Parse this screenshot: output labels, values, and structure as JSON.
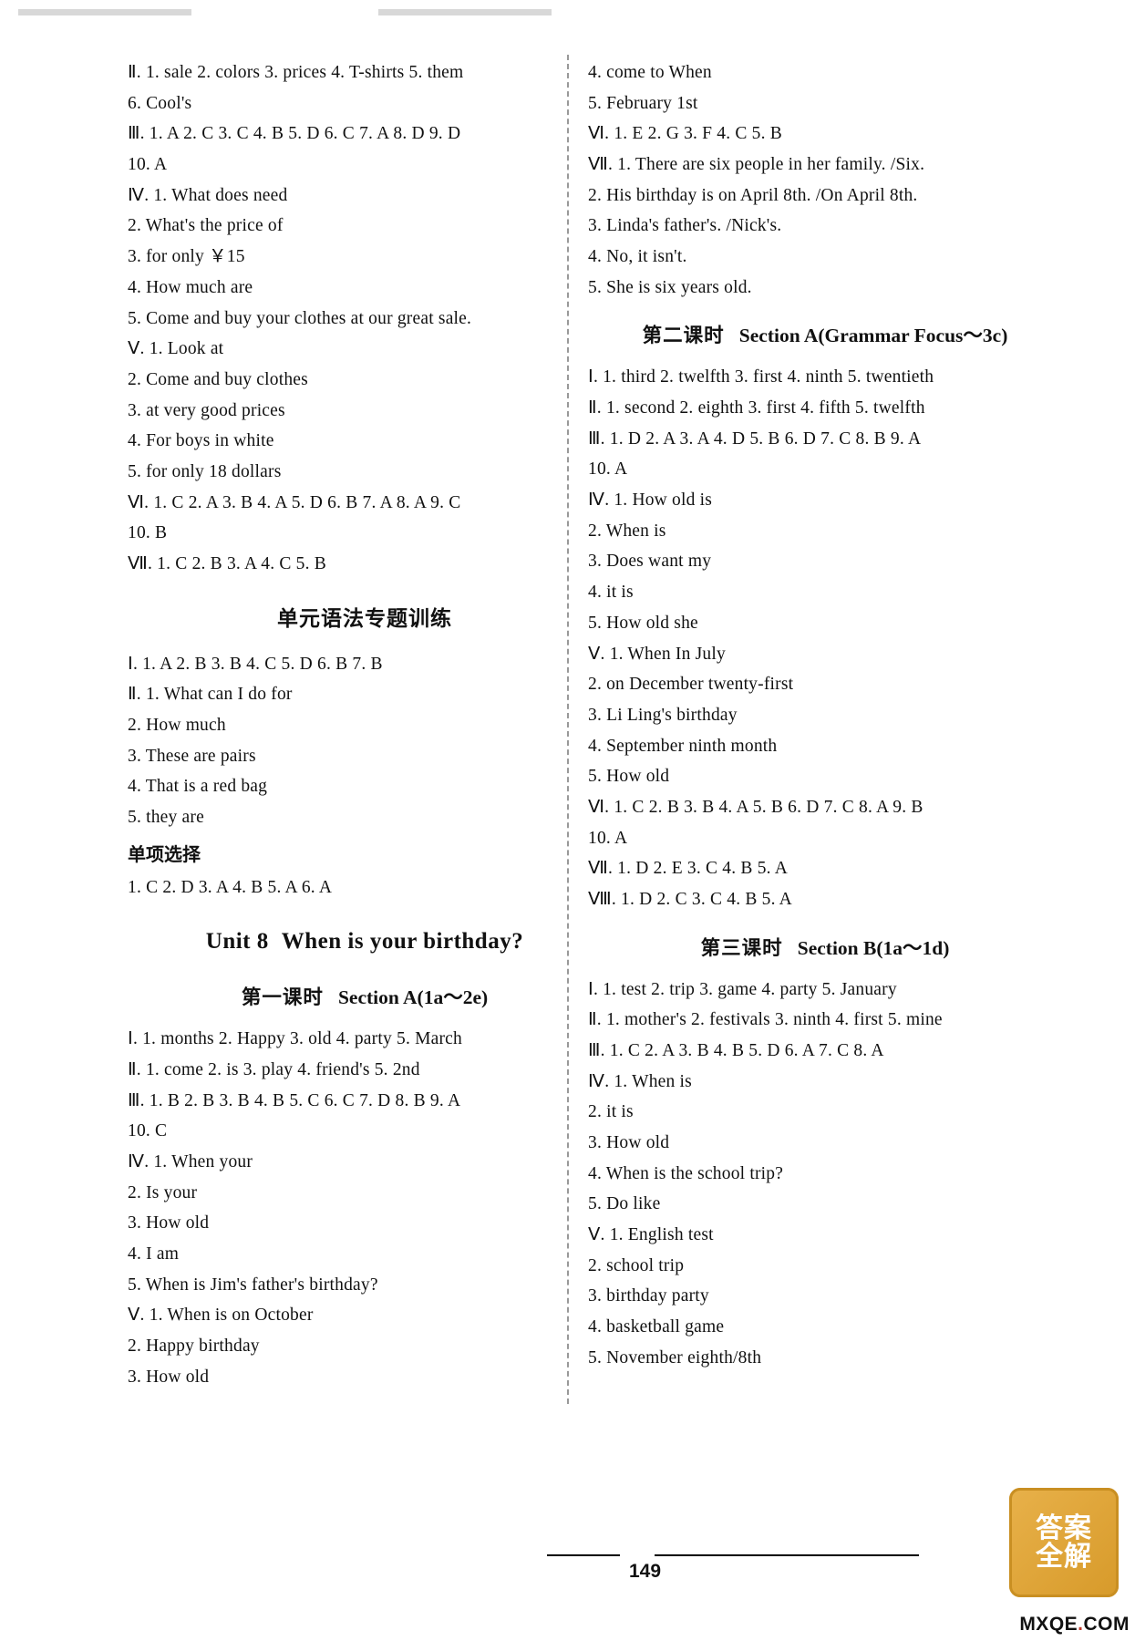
{
  "page": {
    "number": "149",
    "stamp_text": "答案\n全解",
    "watermark": "MXQE.COM"
  },
  "left_column": {
    "lines": [
      "Ⅱ. 1. sale   2. colors   3. prices   4. T-shirts   5. them",
      "6. Cool's",
      "Ⅲ. 1. A   2. C   3. C   4. B   5. D   6. C   7. A   8. D   9. D",
      "10. A",
      "Ⅳ. 1. What   does   need",
      "2. What's   the   price   of",
      "3. for   only   ￥15",
      "4. How   much   are",
      "5. Come and buy your clothes at our great sale.",
      "Ⅴ. 1. Look   at",
      "2. Come   and   buy   clothes",
      "3. at   very   good   prices",
      "4. For   boys   in   white",
      "5. for   only   18   dollars",
      "Ⅵ. 1. C   2. A   3. B   4. A   5. D   6. B   7. A   8. A   9. C",
      "10. B",
      "Ⅶ. 1. C   2. B   3. A   4. C   5. B"
    ],
    "grammar_heading": "单元语法专题训练",
    "grammar_lines": [
      "Ⅰ. 1. A   2. B   3. B   4. C   5. D   6. B   7. B",
      "Ⅱ. 1. What   can   I   do   for",
      "2. How   much",
      "3. These   are   pairs",
      "4. That   is   a   red   bag",
      "5. they   are"
    ],
    "choice_heading": "单项选择",
    "choice_line": "1. C   2. D   3. A   4. B   5. A   6. A",
    "unit_title": {
      "unit": "Unit 8",
      "title": "When is your birthday?"
    },
    "lesson1_title": {
      "prefix": "第一课时",
      "name": "Section A(1a～2e)"
    },
    "lesson1_lines": [
      "Ⅰ. 1. months   2. Happy   3. old   4. party   5. March",
      "Ⅱ. 1. come   2. is   3. play   4. friend's   5. 2nd",
      "Ⅲ. 1. B   2. B   3. B   4. B   5. C   6. C   7. D   8. B   9. A",
      "10. C",
      "Ⅳ. 1. When   your",
      "2. Is   your",
      "3. How   old",
      "4. I   am",
      "5. When is Jim's father's birthday?",
      "Ⅴ. 1. When   is   on   October",
      "2. Happy   birthday",
      "3. How   old"
    ]
  },
  "right_column": {
    "top_lines": [
      "4. come   to   When",
      "5. February   1st",
      "Ⅵ. 1. E   2. G   3. F   4. C   5. B",
      "Ⅶ. 1. There are six people in her family. /Six.",
      "2. His birthday is on April 8th. /On April 8th.",
      "3. Linda's father's. /Nick's.",
      "4. No, it isn't.",
      "5. She is six years old."
    ],
    "lesson2_title": {
      "prefix": "第二课时",
      "name": "Section A(Grammar Focus～3c)"
    },
    "lesson2_lines": [
      "Ⅰ. 1. third   2. twelfth   3. first   4. ninth   5. twentieth",
      "Ⅱ. 1. second   2. eighth   3. first   4. fifth   5. twelfth",
      "Ⅲ. 1. D   2. A   3. A   4. D   5. B   6. D   7. C   8. B   9. A",
      "10. A",
      "Ⅳ. 1. How   old   is",
      "2. When   is",
      "3. Does   want   my",
      "4. it   is",
      "5. How   old   she",
      "Ⅴ. 1. When   In   July",
      "2. on   December   twenty-first",
      "3. Li Ling's   birthday",
      "4. September   ninth   month",
      "5. How   old",
      "Ⅵ. 1. C   2. B   3. B   4. A   5. B   6. D   7. C   8. A   9. B",
      "10. A",
      "Ⅶ. 1. D   2. E   3. C   4. B   5. A",
      "Ⅷ. 1. D   2. C   3. C   4. B   5. A"
    ],
    "lesson3_title": {
      "prefix": "第三课时",
      "name": "Section B(1a～1d)"
    },
    "lesson3_lines": [
      "Ⅰ. 1. test   2. trip   3. game   4. party   5. January",
      "Ⅱ. 1. mother's   2. festivals   3. ninth   4. first   5. mine",
      "Ⅲ. 1. C   2. A   3. B   4. B   5. D   6. A   7. C   8. A",
      "Ⅳ. 1. When   is",
      "2. it   is",
      "3. How   old",
      "4. When is the school trip?",
      "5. Do   like",
      "Ⅴ. 1. English   test",
      "2. school   trip",
      "3. birthday   party",
      "4. basketball   game",
      "5. November   eighth/8th"
    ]
  }
}
